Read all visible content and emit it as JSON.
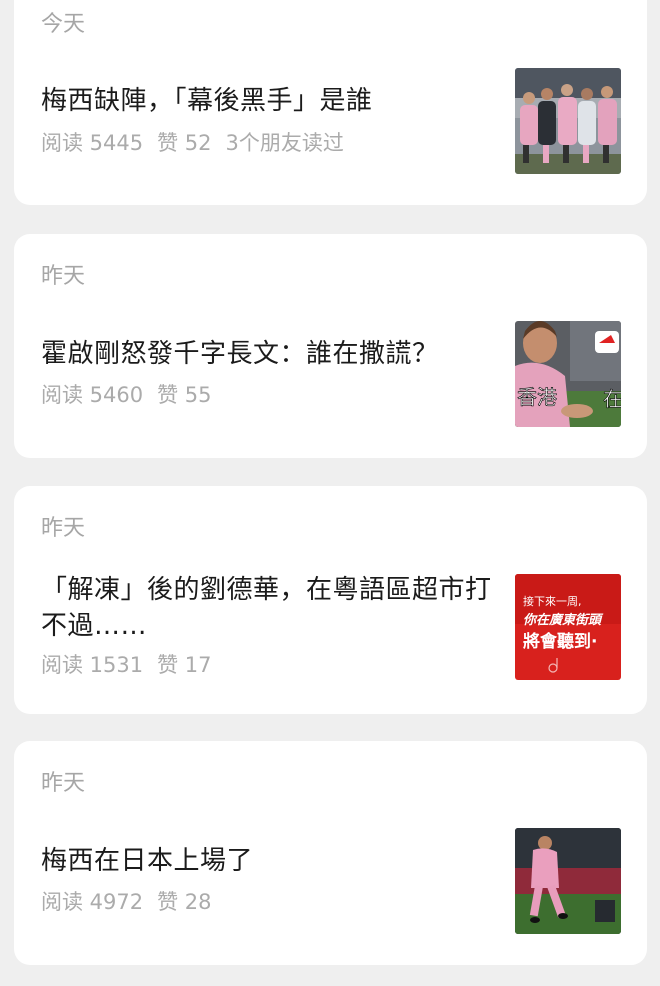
{
  "feed": {
    "items": [
      {
        "date": "今天",
        "title": "梅西缺陣，「幕後黑手」是誰",
        "reads": "阅读 5445",
        "likes": "赞 52",
        "friends": "3个朋友读过",
        "thumbnail": "team-bench-photo"
      },
      {
        "date": "昨天",
        "title": "霍啟剛怒發千字長文：誰在撒謊？",
        "reads": "阅读 5460",
        "likes": "赞 55",
        "thumbnail": "messi-sitting-photo",
        "thumb_text_left": "香港",
        "thumb_text_right": "在"
      },
      {
        "date": "昨天",
        "title": "「解凍」後的劉德華，在粵語區超市打不過……",
        "reads": "阅读 1531",
        "likes": "赞 17",
        "thumbnail": "red-promo-poster",
        "thumb_line1": "接下來一周,",
        "thumb_line2": "你在廣東街頭",
        "thumb_line3": "將會聽到·"
      },
      {
        "date": "昨天",
        "title": "梅西在日本上場了",
        "reads": "阅读 4972",
        "likes": "赞 28",
        "thumbnail": "messi-on-pitch-photo"
      }
    ]
  },
  "colors": {
    "background": "#efefef",
    "card": "#ffffff",
    "title_text": "#1b1b1b",
    "meta_text": "#ababab",
    "date_text": "#a6a6a6",
    "pink_kit": "#e7a6c0",
    "promo_red": "#d8211d"
  }
}
